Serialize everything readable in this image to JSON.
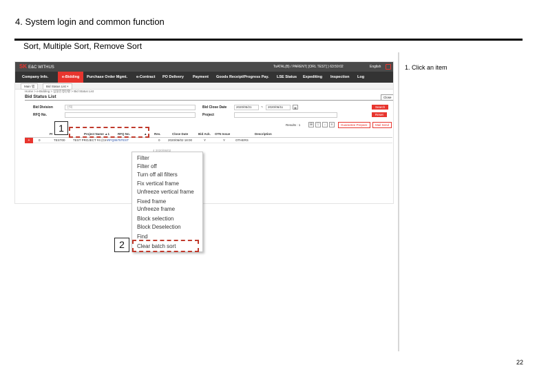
{
  "slide": {
    "title": "4. System login and common function",
    "subtitle": "Sort, Multiple Sort, Remove Sort",
    "step_note": "1. Click an item",
    "page_number": "22"
  },
  "app": {
    "logo_brand": "SK",
    "logo_name": "E&C WITHUS",
    "user_info": "ToATAL(B) / PARENT( [ORL TEST] )  63:59:02",
    "language": "English",
    "nav": [
      "Company Info.",
      "e-Bidding",
      "Purchase Order Mgmt.",
      "e-Contract",
      "PO Delivery",
      "Payment",
      "Goods Receipt/Progress Pay.",
      "LSE Status",
      "Expediting",
      "Inspection",
      "Log"
    ],
    "active_nav": "e-Bidding",
    "tabs": [
      "Main 탭",
      "Bid Status List ×"
    ],
    "breadcrumb": "Home > e-Bidding > 입찰진행현황 > Bid Status List",
    "page_title": "Bid Status List",
    "close_label": "Close",
    "form": {
      "bid_division_label": "Bid Division",
      "bid_division_value": "선택",
      "bid_close_date_label": "Bid Close Date",
      "date_from": "2020/05/21",
      "date_sep": "~",
      "date_to": "2020/06/11",
      "rfq_label": "RFQ No.",
      "project_label": "Project",
      "search_label": "Search",
      "reset_label": "Reset"
    },
    "results": {
      "label": "Results : 1",
      "guarantee_btn": "Guarantee Prepare",
      "mail_send_btn": "Mail Send"
    },
    "grid": {
      "headers": [
        "Pr",
        "Project Name",
        "RFQ No.",
        "Rev.",
        "Close Date",
        "Bid Ack.",
        "OTN Issue",
        "Description"
      ],
      "row": {
        "marker": "+",
        "check": "0",
        "col1": "TEST00",
        "project_name": "TEST PROJECT #4 (Cm",
        "rfq_no": "RFQ0675TEST",
        "rev": "0",
        "close_date": "2020/06/02 18:00",
        "bid_ack": "Y",
        "otn_issue": "Y",
        "description": "OTHERS"
      }
    },
    "ghost_text": "4          2020/06/02"
  },
  "context_menu": {
    "items": [
      "Filter",
      "Filter off",
      "Turn off all filters",
      "Fix vertical frame",
      "Unfreeze vertical frame",
      "Fixed frame",
      "Unfreeze frame",
      "Block selection",
      "Block Deselection",
      "Find",
      "Clear batch sort"
    ]
  },
  "badges": [
    "1",
    "2"
  ],
  "colors": {
    "accent_red": "#e8352e",
    "highlight_red": "#c0392b",
    "nav_dark": "#333333"
  }
}
